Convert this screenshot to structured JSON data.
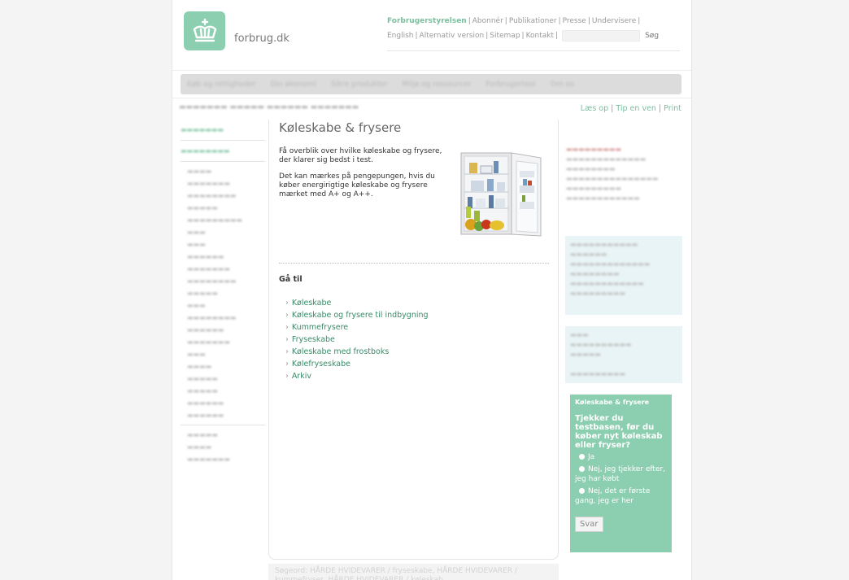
{
  "header": {
    "brand": "forbrug.dk",
    "links": [
      "Forbrugerstyrelsen",
      "Abonnér",
      "Publikationer",
      "Presse",
      "Undervisere"
    ],
    "links2": [
      "English",
      "Alternativ version",
      "Sitemap",
      "Kontakt"
    ],
    "search_button": "Søg"
  },
  "mainnav": {
    "items": [
      "Køb og rettigheder",
      "Din økonomi",
      "Sikre produkter",
      "Miljø og ressourcer",
      "Forbrugertest",
      "Om os"
    ]
  },
  "toolbar": {
    "read_aloud": "Læs op",
    "tip": "Tip en ven",
    "print": "Print"
  },
  "page": {
    "title": "Køleskabe & frysere",
    "intro1": "Få overblik over hvilke køleskabe og frysere, der klarer sig bedst i test.",
    "intro2": "Det kan mærkes på pengepungen, hvis du køber energirigtige køleskabe og frysere mærket med A+ og A++."
  },
  "goto": {
    "title": "Gå til",
    "items": [
      "Køleskabe",
      "Køleskabe og frysere til indbygning",
      "Kummefrysere",
      "Fryseskabe",
      "Køleskabe med frostboks",
      "Kølefryseskabe",
      "Arkiv"
    ]
  },
  "poll": {
    "title": "Køleskabe & frysere",
    "question": "Tjekker du testbasen, før du køber nyt køleskab eller fryser?",
    "options": [
      "Ja",
      "Nej, jeg tjekker efter, jeg har købt",
      "Nej, det er første gang, jeg er her"
    ],
    "submit": "Svar"
  },
  "footer": {
    "crumb": "Søgeord: HÅRDE HVIDEVARER / fryseskabe, HÅRDE HVIDEVARER / kummefryser, HÅRDE HVIDEVARER / køleskab"
  },
  "colors": {
    "brand_green": "#8ccfb0",
    "link_green": "#3a8a68",
    "box_blue": "#e9f4f6"
  }
}
